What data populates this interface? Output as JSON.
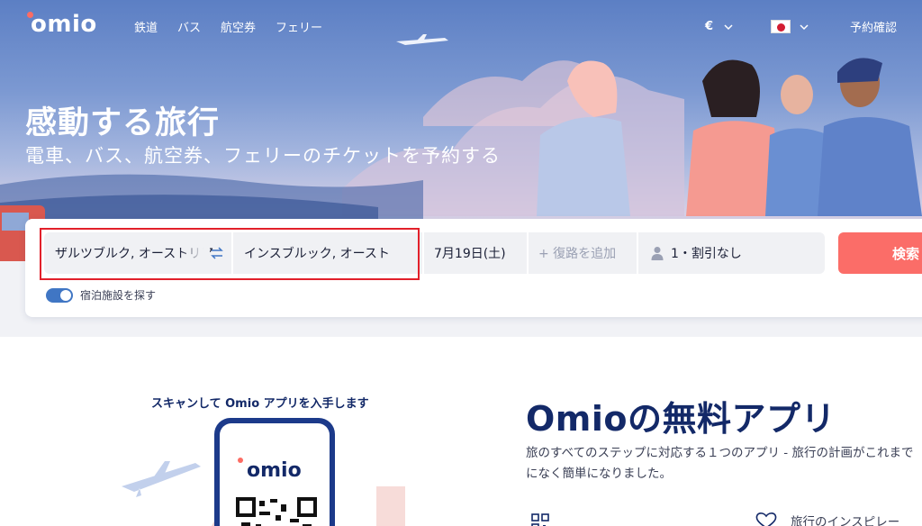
{
  "nav": {
    "logo": "omio",
    "links": [
      "鉄道",
      "バス",
      "航空券",
      "フェリー"
    ],
    "currency": "€",
    "booking": "予約確認"
  },
  "hero": {
    "title": "感動する旅行",
    "subtitle": "電車、バス、航空券、フェリーのチケットを予約する"
  },
  "search": {
    "from": "ザルツブルク, オーストリア",
    "to": "インスブルック, オースト",
    "date": "7月19日(土)",
    "return_placeholder": "+ 復路を追加",
    "passengers": "1・割引なし",
    "search_button": "検索",
    "accommodation_toggle": "宿泊施設を探す"
  },
  "promo": {
    "qr_caption": "スキャンして Omio アプリを入手します",
    "phone_logo": "omio",
    "title": "Omioの無料アプリ",
    "description": "旅のすべてのステップに対応する１つのアプリ - 旅行の計画がこれまでになく簡単になりました。",
    "feature_2": "旅行のインスピレー"
  },
  "colors": {
    "brand_navy": "#132968",
    "accent_coral": "#fb6d68",
    "toggle_blue": "#4076c4",
    "highlight_red": "#e2202a"
  }
}
